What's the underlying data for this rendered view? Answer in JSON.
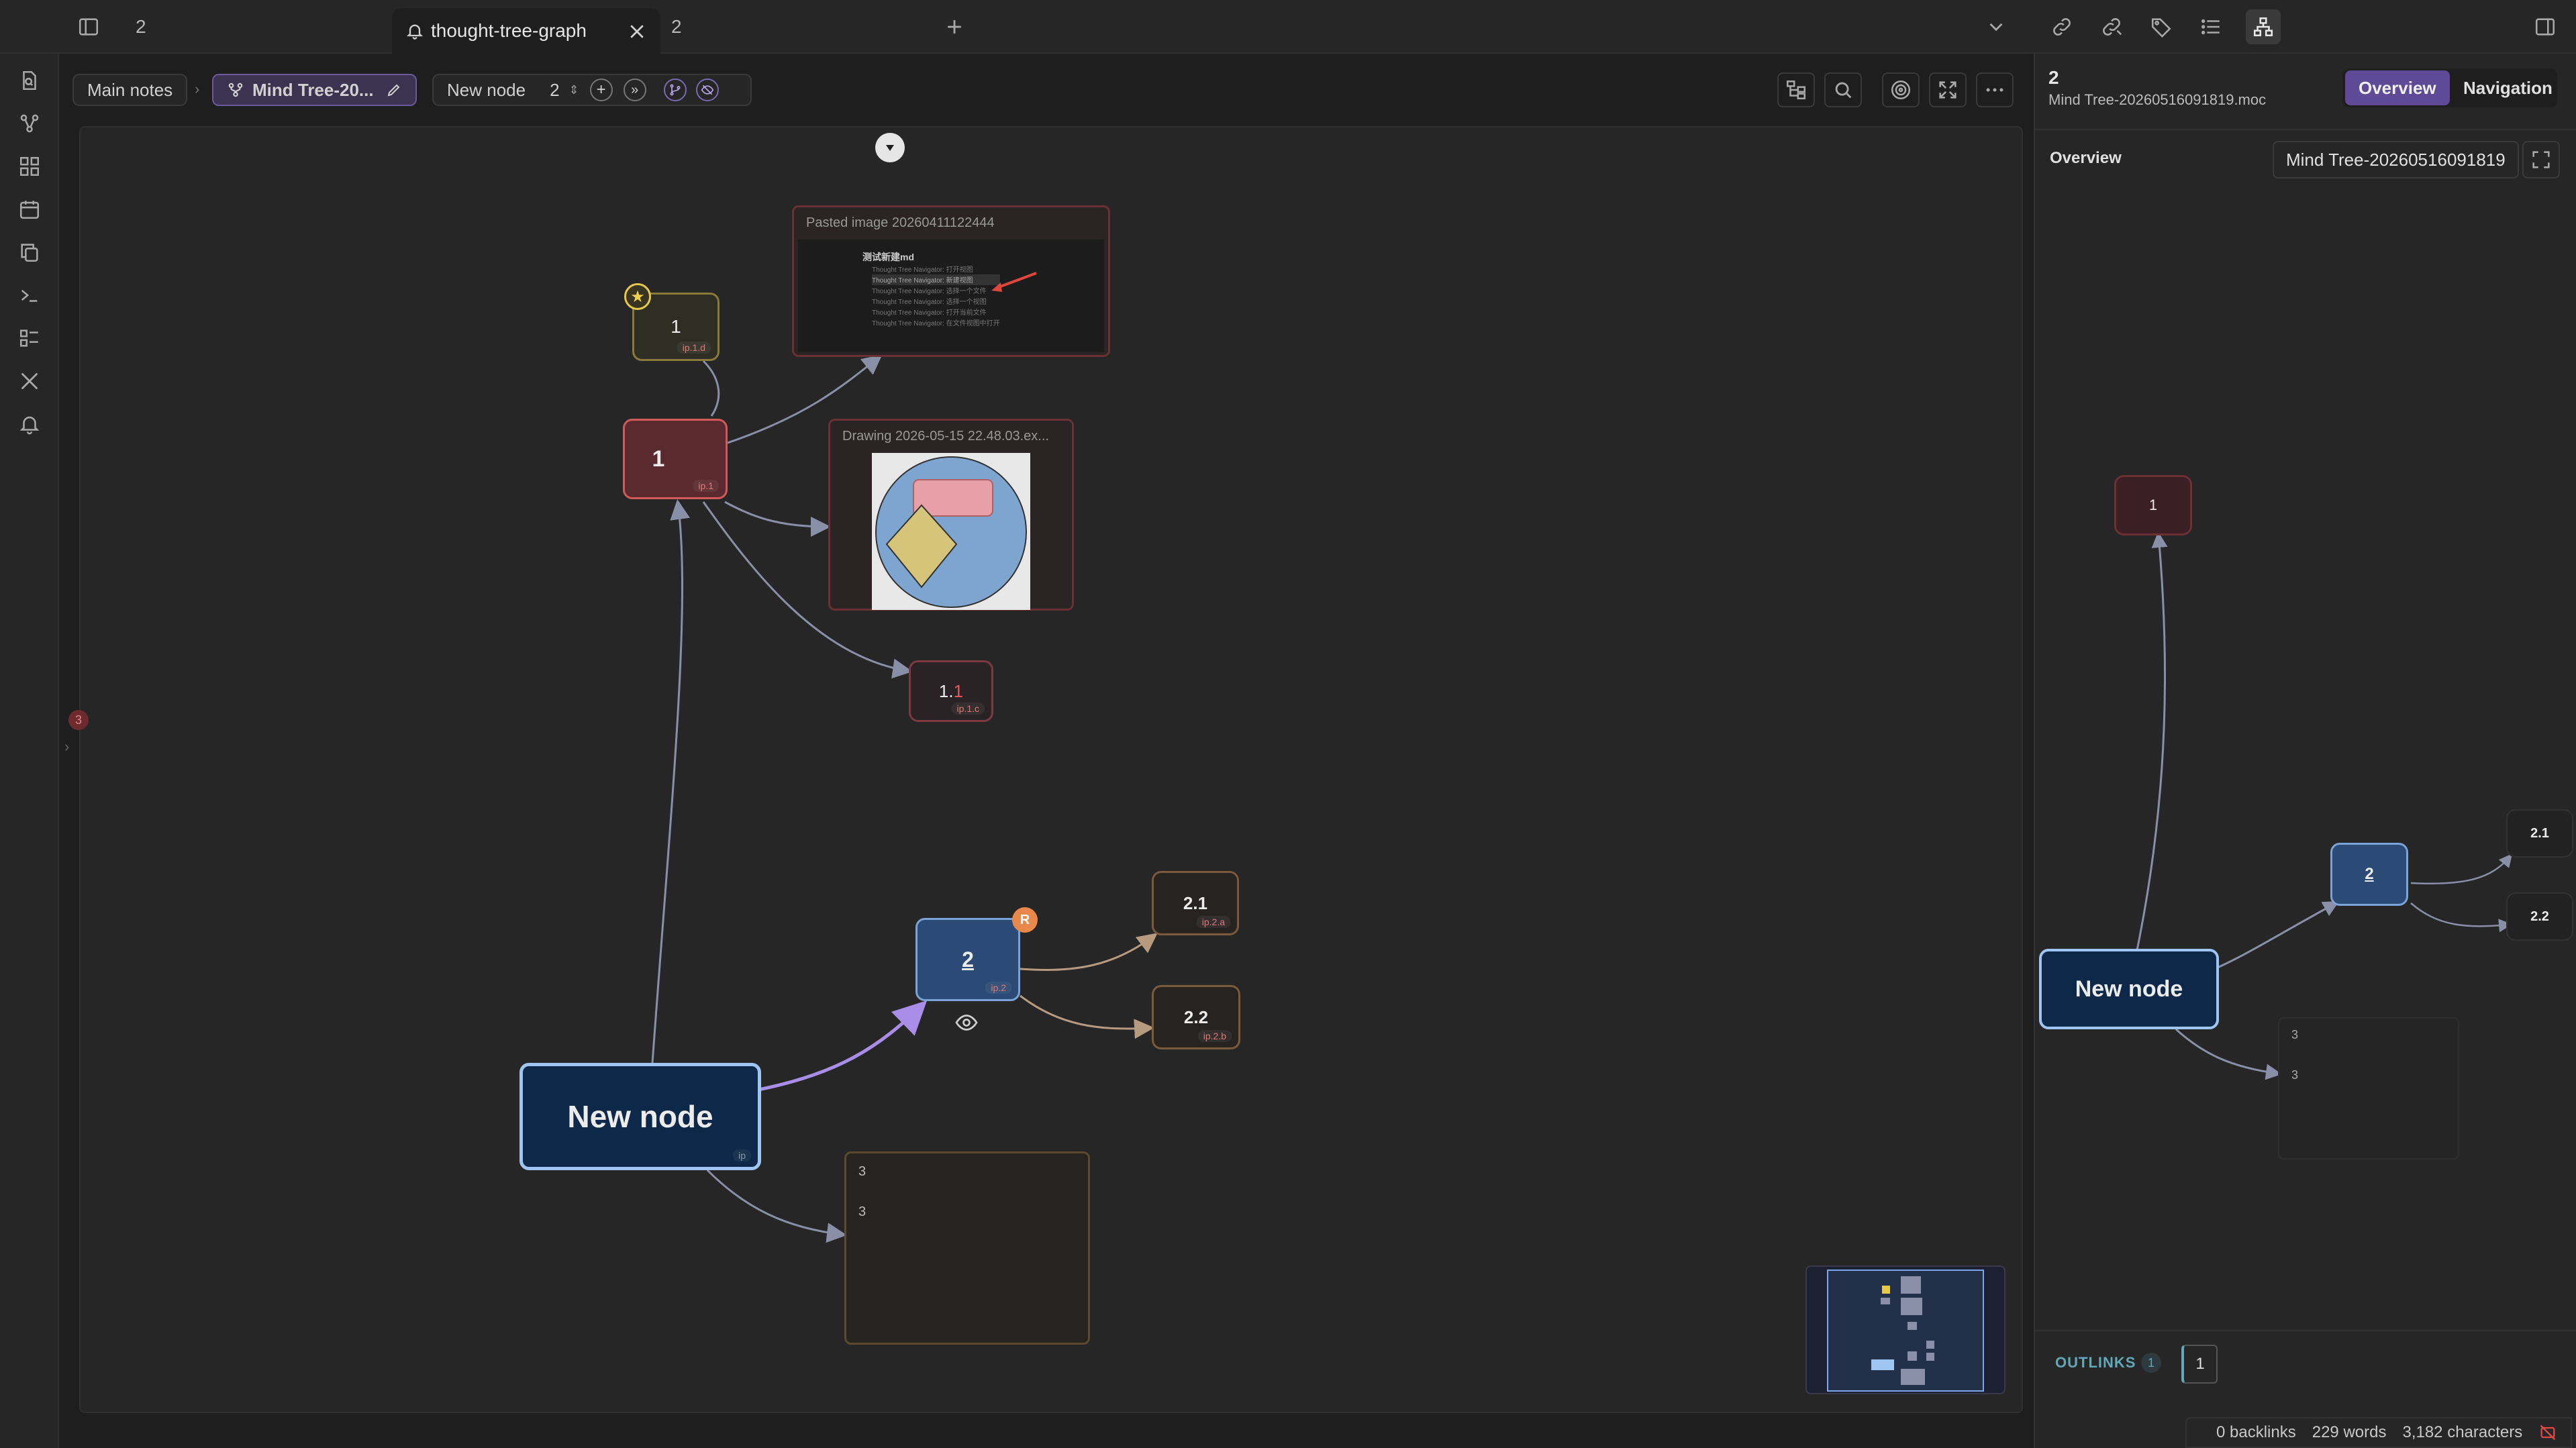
{
  "tabs": {
    "left_tab_label": "2",
    "active_tab_label": "thought-tree-graph",
    "right_tab_label": "2"
  },
  "breadcrumb": {
    "root": "Main notes",
    "file": "Mind Tree-20...",
    "node_label": "New node",
    "node_count": "2"
  },
  "canvas": {
    "pasted_image_title": "Pasted image 20260411122444",
    "pasted_image_heading": "测试新建md",
    "pasted_image_lines": [
      "Thought Tree Navigator: 打开视图",
      "Thought Tree Navigator: 新建视图",
      "Thought Tree Navigator: 选择一个文件",
      "Thought Tree Navigator: 选择一个视图",
      "Thought Tree Navigator: 打开当前文件",
      "Thought Tree Navigator: 在文件视图中打开"
    ],
    "drawing_title": "Drawing 2026-05-15 22.48.03.ex...",
    "nodes": {
      "n1_small": {
        "label": "1",
        "tag": "ip.1.d"
      },
      "n1": {
        "label": "1",
        "tag": "ip.1"
      },
      "n11": {
        "label_main": "1.",
        "label_accent": "1",
        "tag": "ip.1.c"
      },
      "n2": {
        "label": "2",
        "tag": "ip.2",
        "badge": "R"
      },
      "n21": {
        "label": "2.1",
        "tag": "ip.2.a"
      },
      "n22": {
        "label": "2.2",
        "tag": "ip.2.b"
      },
      "new_node": {
        "label": "New node",
        "tag": "ip"
      },
      "n3": {
        "line1": "3",
        "line2": "3"
      }
    },
    "side_count": "3"
  },
  "right": {
    "title": "2",
    "subtitle": "Mind Tree-20260516091819.moc",
    "tab_overview": "Overview",
    "tab_navigation": "Navigation",
    "section": "Overview",
    "file_chip": "Mind Tree-20260516091819",
    "mini": {
      "n1": "1",
      "n2": "2",
      "n21": "2.1",
      "n22": "2.2",
      "new_node": "New node",
      "n3a": "3",
      "n3b": "3"
    },
    "outlinks_label": "OUTLINKS",
    "outlinks_count": "1",
    "outlink_item": "1"
  },
  "status": {
    "backlinks": "0 backlinks",
    "words": "229 words",
    "chars": "3,182 characters"
  },
  "colors": {
    "accent": "#7c5cc4",
    "node_red": "#5a2a2e",
    "node_blue": "#2b4a75",
    "node_navy": "#0d2848",
    "node_border_blue": "#9fc6f2"
  }
}
